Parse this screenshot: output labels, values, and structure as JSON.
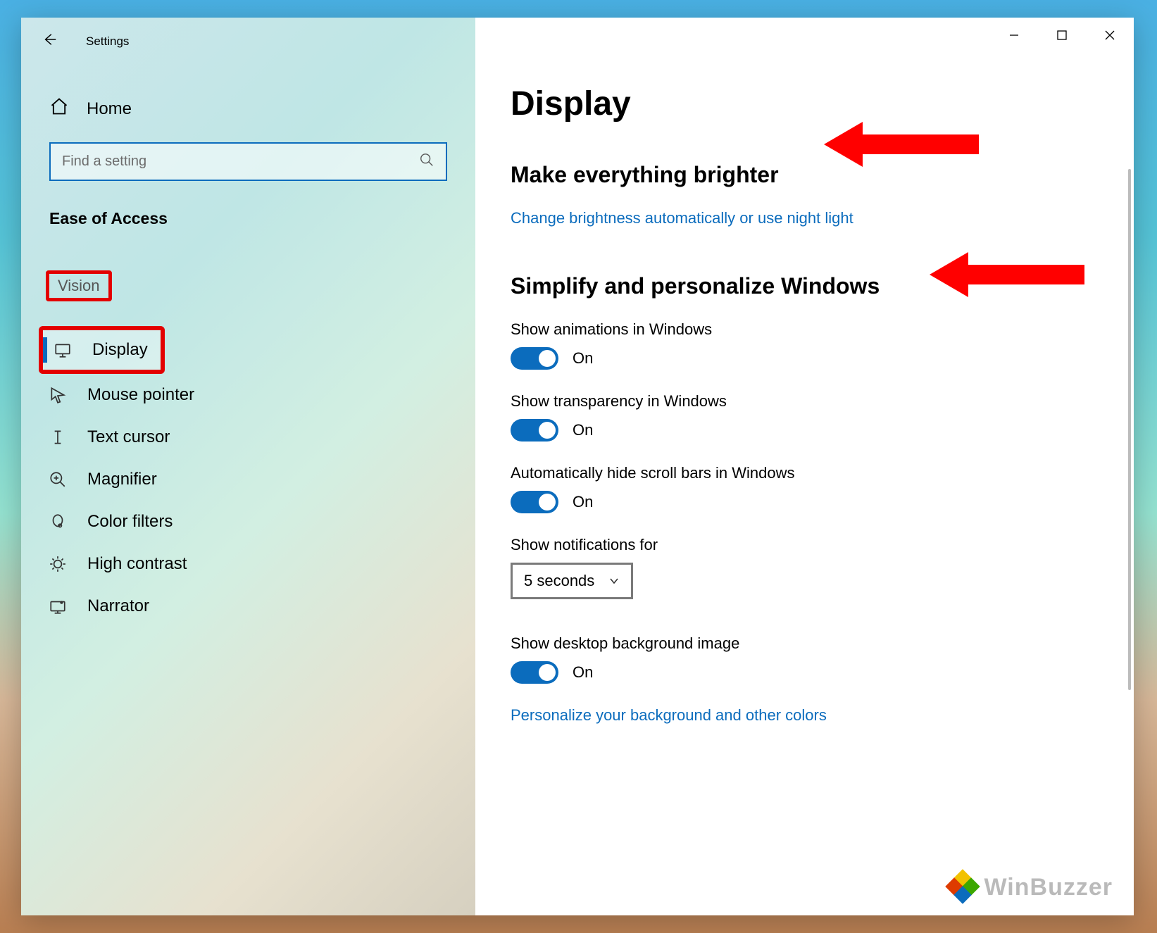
{
  "window": {
    "title": "Settings"
  },
  "sidebar": {
    "home_label": "Home",
    "search_placeholder": "Find a setting",
    "group_title": "Ease of Access",
    "category_title": "Vision",
    "items": [
      {
        "label": "Display",
        "icon": "display-icon",
        "active": true
      },
      {
        "label": "Mouse pointer",
        "icon": "mouse-pointer-icon",
        "active": false
      },
      {
        "label": "Text cursor",
        "icon": "text-cursor-icon",
        "active": false
      },
      {
        "label": "Magnifier",
        "icon": "magnifier-icon",
        "active": false
      },
      {
        "label": "Color filters",
        "icon": "color-filters-icon",
        "active": false
      },
      {
        "label": "High contrast",
        "icon": "high-contrast-icon",
        "active": false
      },
      {
        "label": "Narrator",
        "icon": "narrator-icon",
        "active": false
      }
    ]
  },
  "content": {
    "page_title": "Display",
    "section1": {
      "heading": "Make everything brighter",
      "link": "Change brightness automatically or use night light"
    },
    "section2": {
      "heading": "Simplify and personalize Windows",
      "settings": [
        {
          "label": "Show animations in Windows",
          "state": "On"
        },
        {
          "label": "Show transparency in Windows",
          "state": "On"
        },
        {
          "label": "Automatically hide scroll bars in Windows",
          "state": "On"
        }
      ],
      "notif_label": "Show notifications for",
      "notif_value": "5 seconds",
      "desktop_bg_label": "Show desktop background image",
      "desktop_bg_state": "On",
      "link": "Personalize your background and other colors"
    }
  },
  "watermark": "WinBuzzer"
}
